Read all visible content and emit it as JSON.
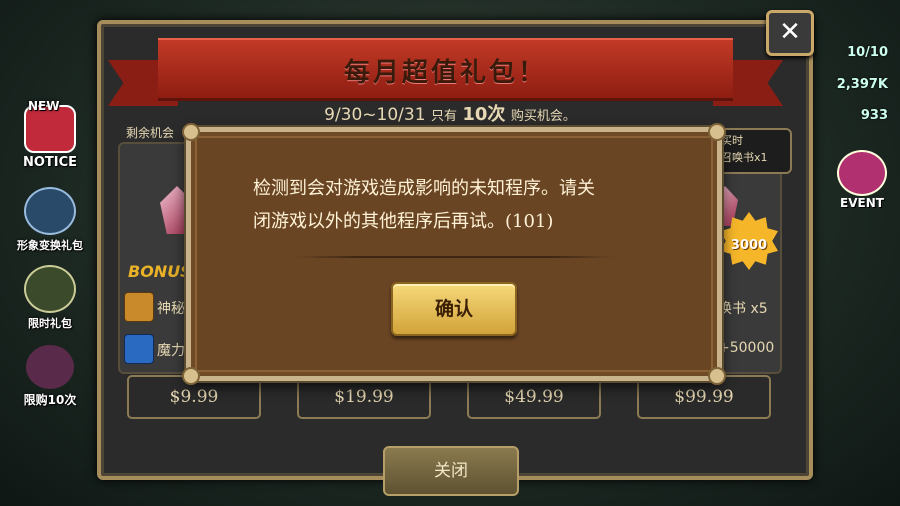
{
  "left_menu": [
    {
      "label": "NOTICE",
      "icon": "notice-icon"
    },
    {
      "label": "形象变换礼包",
      "icon": "costume-icon"
    },
    {
      "label": "限时礼包",
      "icon": "gift-icon"
    },
    {
      "label": "限购10次",
      "icon": "crystal-icon"
    }
  ],
  "left_new_label": "NEW",
  "right_stats": {
    "top": "10/10",
    "gold": "2,397K",
    "gem": "933"
  },
  "right_event_label": "EVENT",
  "popup": {
    "title": "每月超值礼包！",
    "date_range": "9/30~10/31",
    "only_label": "只有",
    "times": "10次",
    "purchase_chance": "购买机会。",
    "remain_label": "剩余机会",
    "bonus_label": "BONUS",
    "items": [
      {
        "label": "神秘",
        "icon": "scroll-icon"
      },
      {
        "label": "魔力",
        "icon": "mana-crystal-icon"
      }
    ],
    "right_items": [
      "唤书 x5",
      "+50000"
    ],
    "tooltip": [
      "购买时",
      "的召唤书x1"
    ],
    "badge_value": "3000",
    "prices": [
      "$9.99",
      "$19.99",
      "$49.99",
      "$99.99"
    ],
    "close_label": "关闭"
  },
  "dialog": {
    "message_line1": "检测到会对游戏造成影响的未知程序。请关",
    "message_line2": "闭游戏以外的其他程序后再试。(101)",
    "confirm_label": "确认"
  },
  "colors": {
    "ribbon": "#c23a26",
    "dialog_bg": "#6e4a26",
    "confirm": "#e9c257",
    "bonus": "#e9b227"
  }
}
